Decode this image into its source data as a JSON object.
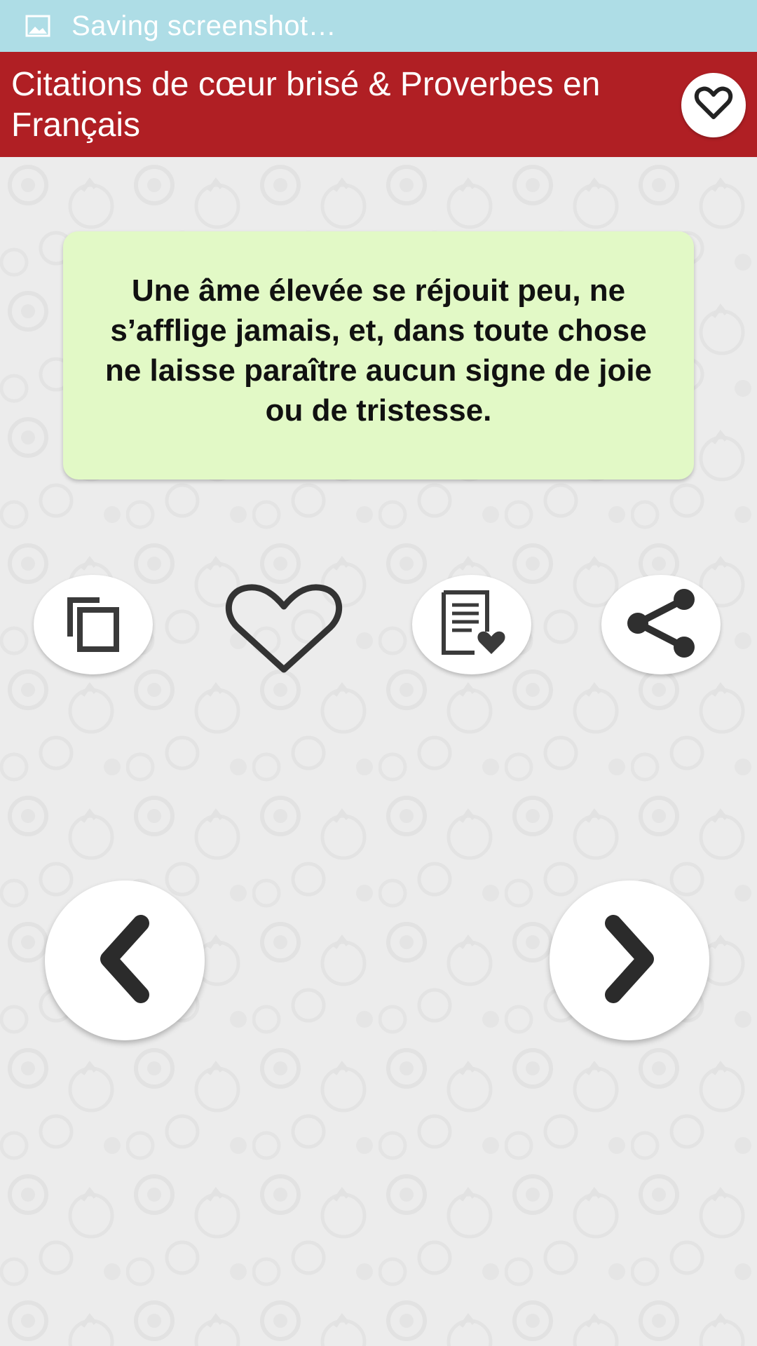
{
  "status_bar": {
    "text": "Saving screenshot…",
    "icon": "image-icon",
    "background": "#aedde6"
  },
  "app_bar": {
    "title": "Citations de cœur brisé & Proverbes en Français",
    "background": "#b01f24",
    "favorites_icon": "heart-outline-icon"
  },
  "quote": {
    "text": "Une âme élevée se réjouit peu, ne s’afflige jamais, et, dans toute chose ne laisse paraître aucun signe de joie ou de tristesse.",
    "card_color": "#e2f9c6"
  },
  "actions": [
    {
      "name": "copy",
      "icon": "copy-icon"
    },
    {
      "name": "favorite",
      "icon": "heart-outline-icon"
    },
    {
      "name": "favorites-list",
      "icon": "document-heart-icon"
    },
    {
      "name": "share",
      "icon": "share-icon"
    }
  ],
  "navigation": {
    "previous_icon": "chevron-left-icon",
    "next_icon": "chevron-right-icon"
  }
}
